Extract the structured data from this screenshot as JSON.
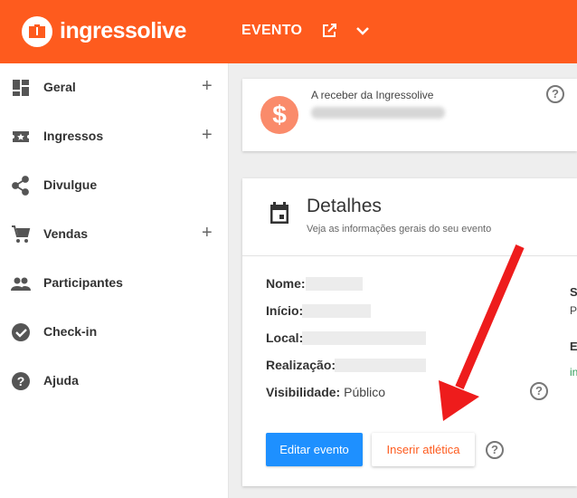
{
  "header": {
    "brand": "ingressolive",
    "event_label": "EVENTO",
    "external_icon": "open-external-icon",
    "dropdown_icon": "chevron-down-icon",
    "color": "#fe5b1e"
  },
  "sidebar": {
    "items": [
      {
        "label": "Geral",
        "icon": "dashboard-icon",
        "expandable": true
      },
      {
        "label": "Ingressos",
        "icon": "ticket-icon",
        "expandable": true
      },
      {
        "label": "Divulgue",
        "icon": "share-icon",
        "expandable": false
      },
      {
        "label": "Vendas",
        "icon": "cart-icon",
        "expandable": true
      },
      {
        "label": "Participantes",
        "icon": "people-icon",
        "expandable": false
      },
      {
        "label": "Check-in",
        "icon": "check-circle-icon",
        "expandable": false
      },
      {
        "label": "Ajuda",
        "icon": "help-icon",
        "expandable": false
      }
    ],
    "plus": "+"
  },
  "receivable": {
    "label": "A receber da Ingressolive",
    "currency_symbol": "$",
    "help": "?"
  },
  "details": {
    "title": "Detalhes",
    "subtitle": "Veja as informações gerais do seu evento",
    "fields": {
      "nome": "Nome:",
      "inicio": "Início:",
      "local": "Local:",
      "realizacao": "Realização:",
      "visibilidade": "Visibilidade:",
      "visibilidade_value": "Público"
    },
    "right_column": {
      "s": "S",
      "p": "P",
      "e": "E",
      "in": "in"
    },
    "help": "?",
    "edit_button": "Editar evento",
    "insert_button": "Inserir atlética",
    "primary_color": "#1e90ff"
  },
  "annotation_arrow_color": "#ee1c1c"
}
